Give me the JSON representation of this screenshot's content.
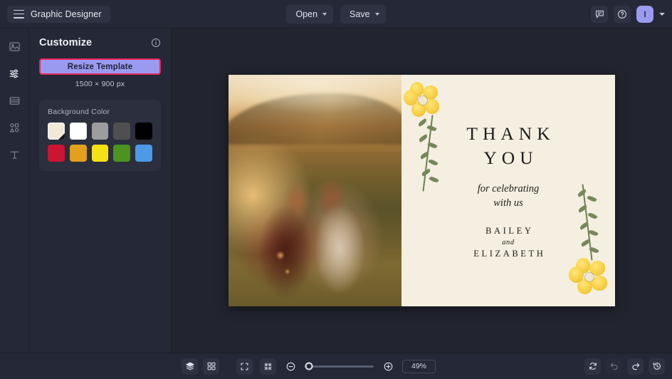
{
  "header": {
    "brand_title": "Graphic Designer",
    "menu_icon": "hamburger-icon",
    "open_label": "Open",
    "save_label": "Save",
    "comment_icon": "comment-icon",
    "help_icon": "help-circle-icon",
    "avatar_initial": "I",
    "avatar_color": "#9a9bf0"
  },
  "rail": {
    "items": [
      {
        "icon": "image-icon",
        "active": false
      },
      {
        "icon": "sliders-icon",
        "active": true
      },
      {
        "icon": "layout-icon",
        "active": false
      },
      {
        "icon": "shapes-icon",
        "active": false
      },
      {
        "icon": "text-icon",
        "active": false
      }
    ]
  },
  "panel": {
    "title": "Customize",
    "info_icon": "info-circle-icon",
    "resize_label": "Resize Template",
    "resize_highlight_color": "#e8265e",
    "dimensions": "1500 × 900 px",
    "background_color": {
      "label": "Background Color",
      "swatches": [
        {
          "name": "cream",
          "hex": "#f1e9d6",
          "selected": true
        },
        {
          "name": "white",
          "hex": "#ffffff",
          "selected": false
        },
        {
          "name": "gray",
          "hex": "#9d9d9d",
          "selected": false
        },
        {
          "name": "dark-gray",
          "hex": "#4f4f4f",
          "selected": false
        },
        {
          "name": "black",
          "hex": "#000000",
          "selected": false
        },
        {
          "name": "crimson",
          "hex": "#cc1433",
          "selected": false
        },
        {
          "name": "orange",
          "hex": "#e3a01c",
          "selected": false
        },
        {
          "name": "yellow",
          "hex": "#f5e215",
          "selected": false
        },
        {
          "name": "green",
          "hex": "#4c9320",
          "selected": false
        },
        {
          "name": "blue",
          "hex": "#4d9ae8",
          "selected": false
        }
      ]
    }
  },
  "canvas": {
    "background_hex": "#f4efe0",
    "card": {
      "heading_line1": "THANK",
      "heading_line2": "YOU",
      "script_line1": "for celebrating",
      "script_line2": "with us",
      "name1": "BAILEY",
      "connector": "and",
      "name2": "ELIZABETH"
    },
    "photo_alt": "Couple at golden hour in a field"
  },
  "bottombar": {
    "layers_icon": "layers-icon",
    "grid_icon": "grid-icon",
    "fullscreen_icon": "fullscreen-icon",
    "fit_icon": "fit-to-screen-icon",
    "zoom_out_icon": "zoom-out-icon",
    "zoom_in_icon": "zoom-in-icon",
    "zoom_value": "49%",
    "zoom_slider_percent": 6,
    "refresh_icon": "refresh-icon",
    "undo_icon": "undo-icon",
    "redo_icon": "redo-icon",
    "history_icon": "history-icon"
  }
}
